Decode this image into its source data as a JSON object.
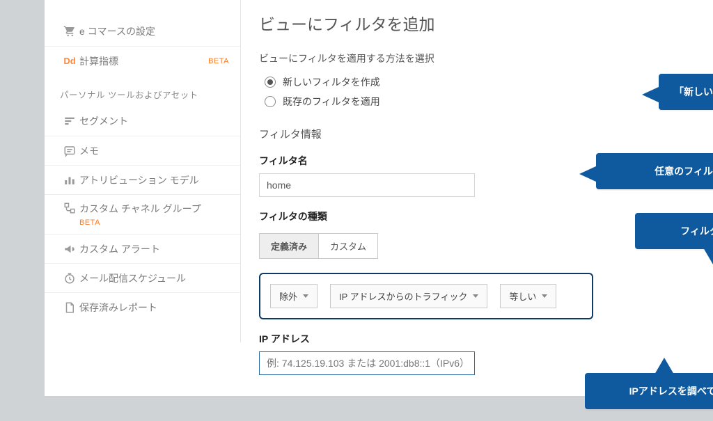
{
  "sidebar": {
    "items": [
      {
        "label": "e コマースの設定"
      },
      {
        "label": "計算指標",
        "beta": "BETA"
      }
    ],
    "personal_header": "パーソナル ツールおよびアセット",
    "personal_items": [
      {
        "label": "セグメント"
      },
      {
        "label": "メモ"
      },
      {
        "label": "アトリビューション モデル"
      },
      {
        "label": "カスタム チャネル グループ",
        "beta": "BETA"
      },
      {
        "label": "カスタム アラート"
      },
      {
        "label": "メール配信スケジュール"
      },
      {
        "label": "保存済みレポート"
      }
    ]
  },
  "main": {
    "title": "ビューにフィルタを追加",
    "method_label": "ビューにフィルタを適用する方法を選択",
    "radio_create": "新しいフィルタを作成",
    "radio_existing": "既存のフィルタを適用",
    "filter_info_heading": "フィルタ情報",
    "filter_name_label": "フィルタ名",
    "filter_name_value": "home",
    "filter_type_label": "フィルタの種類",
    "tab_predefined": "定義済み",
    "tab_custom": "カスタム",
    "dd1": "除外",
    "dd2": "IP アドレスからのトラフィック",
    "dd3": "等しい",
    "ip_label": "IP アドレス",
    "ip_placeholder": "例: 74.125.19.103 または 2001:db8::1（IPv6）"
  },
  "callouts": {
    "c1": "「新しいフィルタを作成」で選択",
    "c2": "任意のフィルタ名（後から変えられる）",
    "c3": "フィルタの条件を設定",
    "c4": "IPアドレスを調べて入力（後から変えられる）"
  }
}
